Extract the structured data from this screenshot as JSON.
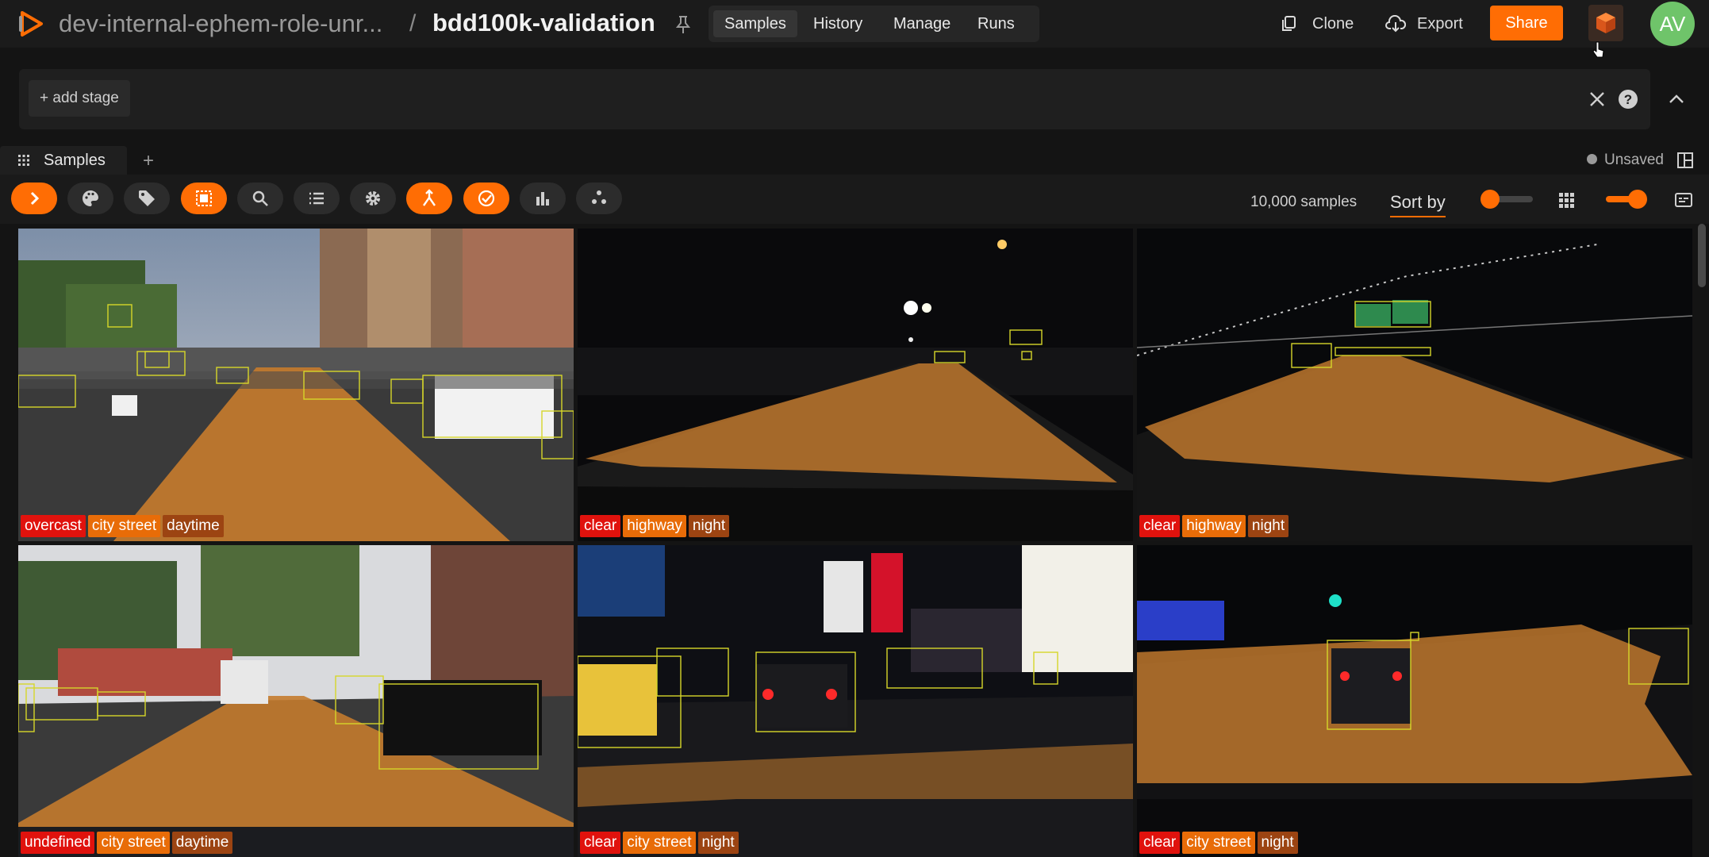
{
  "header": {
    "dataset_name": "dev-internal-ephem-role-unr...",
    "separator": "/",
    "view_name": "bdd100k-validation",
    "tabs": [
      {
        "label": "Samples",
        "active": true
      },
      {
        "label": "History",
        "active": false
      },
      {
        "label": "Manage",
        "active": false
      },
      {
        "label": "Runs",
        "active": false
      }
    ],
    "clone_label": "Clone",
    "export_label": "Export",
    "share_label": "Share",
    "avatar_initials": "AV"
  },
  "view_bar": {
    "add_stage_label": "+ add stage"
  },
  "panel": {
    "tab_label": "Samples",
    "add_tab_label": "+",
    "status_label": "Unsaved"
  },
  "toolbar": {
    "buttons": [
      {
        "icon": "chevron-right-icon",
        "active": true
      },
      {
        "icon": "palette-icon",
        "active": false
      },
      {
        "icon": "tag-icon",
        "active": false
      },
      {
        "icon": "selection-icon",
        "active": true
      },
      {
        "icon": "search-icon",
        "active": false
      },
      {
        "icon": "list-icon",
        "active": false
      },
      {
        "icon": "settings-icon",
        "active": false
      },
      {
        "icon": "merge-icon",
        "active": true
      },
      {
        "icon": "check-circle-icon",
        "active": true
      },
      {
        "icon": "bar-chart-icon",
        "active": false
      },
      {
        "icon": "scatter-icon",
        "active": false
      }
    ],
    "sample_count": "10,000 samples",
    "sort_label": "Sort by"
  },
  "samples": [
    {
      "weather": "overcast",
      "scene": "city street",
      "time": "daytime",
      "kind": "day-city-1"
    },
    {
      "weather": "clear",
      "scene": "highway",
      "time": "night",
      "kind": "night-hwy-1"
    },
    {
      "weather": "clear",
      "scene": "highway",
      "time": "night",
      "kind": "night-hwy-2"
    },
    {
      "weather": "undefined",
      "scene": "city street",
      "time": "daytime",
      "kind": "day-city-2"
    },
    {
      "weather": "clear",
      "scene": "city street",
      "time": "night",
      "kind": "night-city-1"
    },
    {
      "weather": "clear",
      "scene": "city street",
      "time": "night",
      "kind": "night-city-2"
    }
  ],
  "colors": {
    "accent": "#ff6d04",
    "tag_weather": "#e0120d",
    "tag_scene": "#e86c08",
    "tag_time": "#9c4412",
    "drivable_area": "#c47b2e",
    "box_outline": "#d6d62a"
  }
}
